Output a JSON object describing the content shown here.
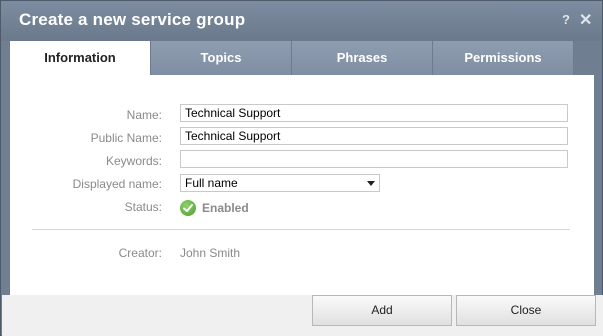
{
  "window": {
    "title": "Create a new service group",
    "help_label": "?",
    "close_label": "✕"
  },
  "tabs": [
    {
      "label": "Information",
      "active": true
    },
    {
      "label": "Topics",
      "active": false
    },
    {
      "label": "Phrases",
      "active": false
    },
    {
      "label": "Permissions",
      "active": false
    }
  ],
  "form": {
    "name_label": "Name:",
    "name_value": "Technical Support",
    "public_name_label": "Public Name:",
    "public_name_value": "Technical Support",
    "keywords_label": "Keywords:",
    "keywords_value": "",
    "displayed_name_label": "Displayed name:",
    "displayed_name_value": "Full name",
    "status_label": "Status:",
    "status_value": "Enabled",
    "creator_label": "Creator:",
    "creator_value": "John Smith"
  },
  "footer": {
    "add_label": "Add",
    "close_label": "Close"
  },
  "colors": {
    "status_ok": "#4e9c2f",
    "titlebar": "#7d8ca0",
    "tab_inactive": "#8e9db0"
  }
}
